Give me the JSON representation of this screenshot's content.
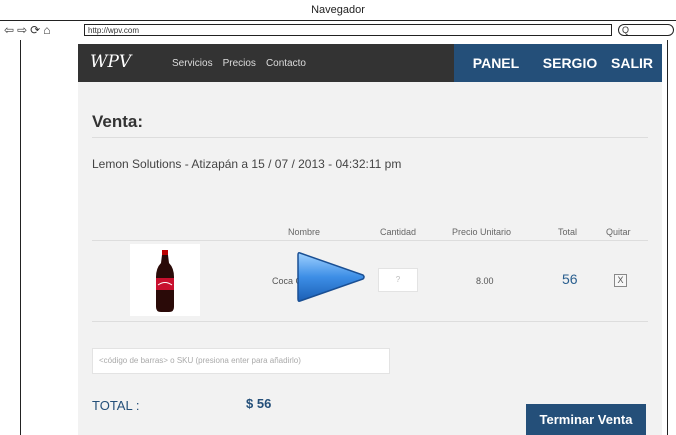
{
  "window": {
    "title": "Navegador"
  },
  "browser": {
    "url": "http://wpv.com",
    "search_glyph": "Q"
  },
  "topbar": {
    "logo": "WPV",
    "menu": [
      "Servicios",
      "Precios",
      "Contacto"
    ],
    "panel": "PANEL",
    "user": "SERGIO",
    "logout": "SALIR"
  },
  "sale": {
    "title": "Venta:",
    "meta": "Lemon Solutions - Atizapán a 15 / 07 / 2013 - 04:32:11 pm",
    "columns": {
      "name": "Nombre",
      "qty": "Cantidad",
      "unit_price": "Precio Unitario",
      "total": "Total",
      "remove": "Quitar"
    },
    "item": {
      "name": "Coca C",
      "qty_placeholder": "?",
      "unit_price": "8.00",
      "total": "56",
      "remove_label": "X"
    },
    "barcode_placeholder": "<código de barras> o SKU (presiona enter para añadirlo)",
    "total_label": "TOTAL :",
    "total_value": "$ 56",
    "finish_button": "Terminar Venta"
  },
  "colors": {
    "accent": "#244f79",
    "bar": "#333333",
    "content_bg": "#f2f2f2"
  }
}
